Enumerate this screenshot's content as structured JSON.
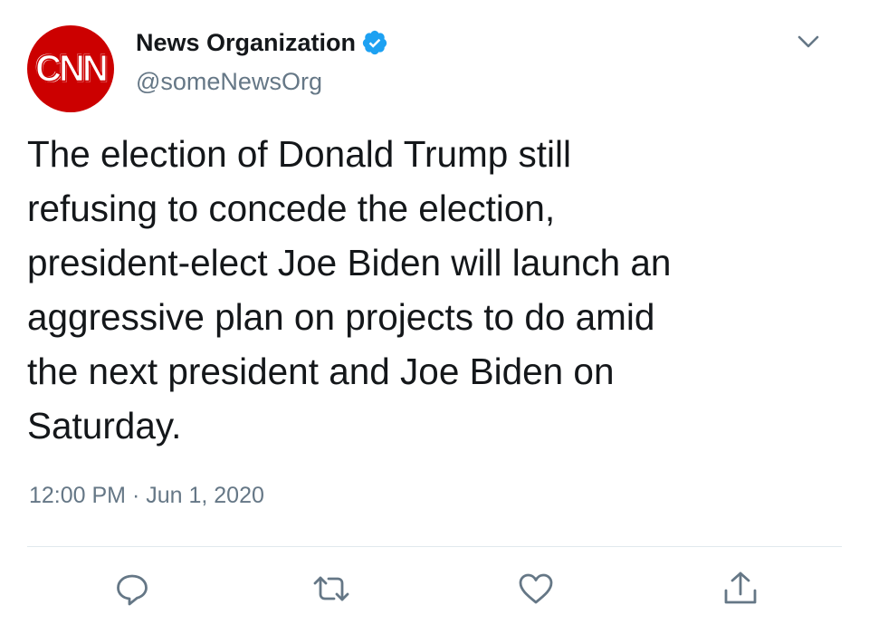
{
  "author": {
    "avatar_text": "CNN",
    "display_name": "News Organization",
    "handle": "@someNewsOrg",
    "verified": true
  },
  "tweet": {
    "text": "The election of Donald Trump still\nrefusing to concede the election,\npresident-elect Joe Biden will launch an\naggressive plan on projects to do amid\nthe next president and Joe Biden on\nSaturday.",
    "timestamp": "12:00 PM · Jun 1, 2020"
  },
  "actions": {
    "reply_icon": "reply-icon",
    "retweet_icon": "retweet-icon",
    "like_icon": "heart-icon",
    "share_icon": "share-icon",
    "more_icon": "chevron-down-icon"
  },
  "colors": {
    "text_primary": "#14171a",
    "text_secondary": "#657786",
    "verified_blue": "#1da1f2",
    "avatar_red": "#cc0000",
    "divider": "#e1e8ed"
  }
}
